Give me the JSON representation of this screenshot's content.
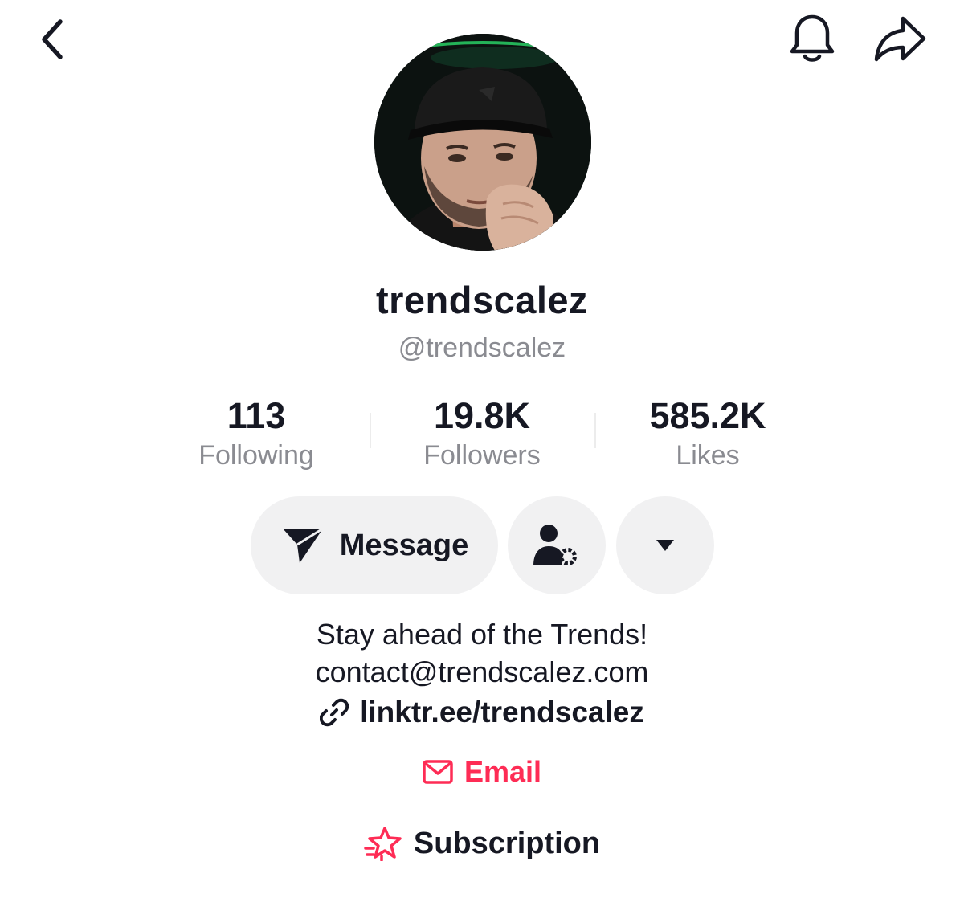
{
  "header": {
    "back_icon": "chevron-left-icon",
    "notification_icon": "bell-icon",
    "share_icon": "share-arrow-icon"
  },
  "profile": {
    "display_name": "trendscalez",
    "username": "@trendscalez"
  },
  "stats": [
    {
      "value": "113",
      "label": "Following"
    },
    {
      "value": "19.8K",
      "label": "Followers"
    },
    {
      "value": "585.2K",
      "label": "Likes"
    }
  ],
  "actions": {
    "message_label": "Message",
    "message_icon": "paper-plane-icon",
    "friend_settings_icon": "user-settings-icon",
    "more_icon": "caret-down-icon"
  },
  "bio": {
    "line1": "Stay ahead of the Trends!",
    "line2": "contact@trendscalez.com"
  },
  "link": {
    "icon": "link-icon",
    "text": "linktr.ee/trendscalez"
  },
  "email": {
    "icon": "envelope-icon",
    "label": "Email"
  },
  "subscription": {
    "icon": "star-badge-icon",
    "label": "Subscription"
  },
  "colors": {
    "text": "#161823",
    "secondary_text": "#8a8b91",
    "button_bg": "#f1f1f2",
    "accent": "#fe2c55"
  }
}
